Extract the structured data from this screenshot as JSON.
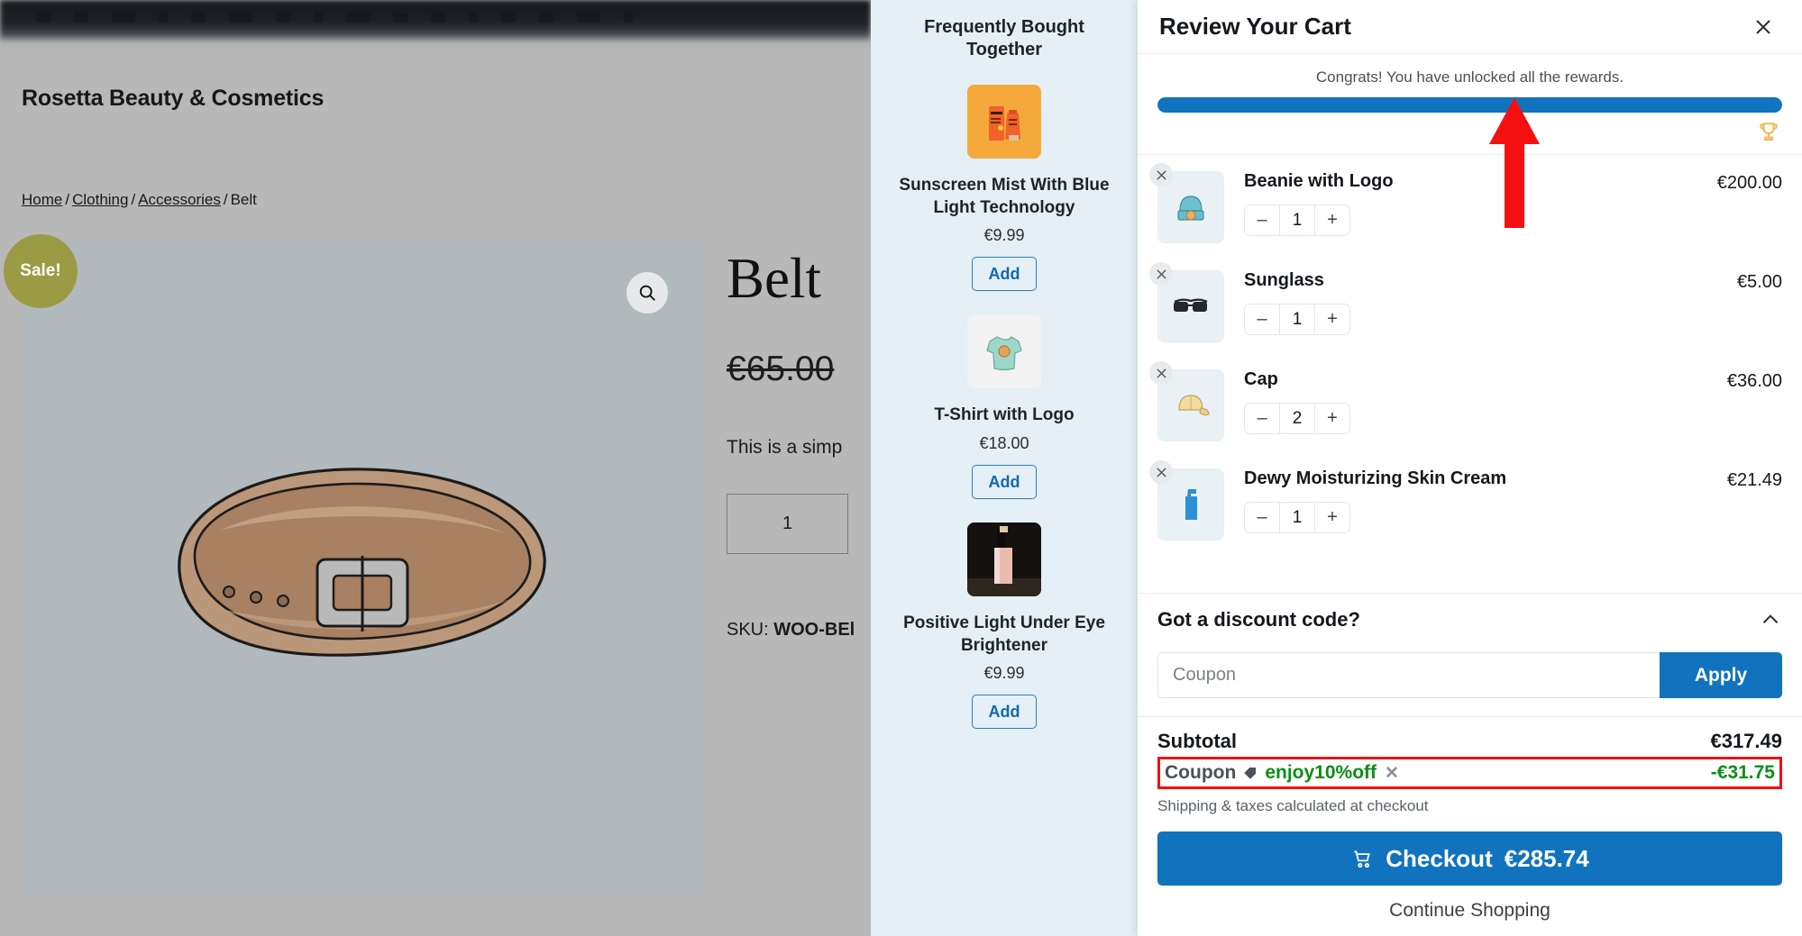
{
  "store": {
    "name": "Rosetta Beauty & Cosmetics",
    "breadcrumb": [
      {
        "label": "Home",
        "link": true
      },
      {
        "label": "Clothing",
        "link": true
      },
      {
        "label": "Accessories",
        "link": true
      },
      {
        "label": "Belt",
        "link": false
      }
    ],
    "breadcrumb_separator": "/"
  },
  "product": {
    "sale_badge": "Sale!",
    "title": "Belt",
    "old_price": "€65.00",
    "description": "This is a simp",
    "quantity": "1",
    "sku_label": "SKU:",
    "sku_value": "WOO-BEl",
    "zoom_icon": "search-icon"
  },
  "fbt": {
    "title": "Frequently Bought Together",
    "items": [
      {
        "name": "Sunscreen Mist With Blue Light Technology",
        "price": "€9.99",
        "add_label": "Add",
        "thumb": "sunscreen-tubes"
      },
      {
        "name": "T-Shirt with Logo",
        "price": "€18.00",
        "add_label": "Add",
        "thumb": "tshirt"
      },
      {
        "name": "Positive Light Under Eye Brightener",
        "price": "€9.99",
        "add_label": "Add",
        "thumb": "serum-bottle"
      }
    ]
  },
  "cart": {
    "title": "Review Your Cart",
    "close_icon": "close-icon",
    "rewards": {
      "message": "Congrats! You have unlocked all the rewards.",
      "progress_percent": 100,
      "trophy_icon": "trophy-icon"
    },
    "items": [
      {
        "name": "Beanie with Logo",
        "price": "€200.00",
        "qty": "1",
        "thumb": "beanie",
        "remove_icon": "close-icon",
        "minus": "–",
        "plus": "+"
      },
      {
        "name": "Sunglass",
        "price": "€5.00",
        "qty": "1",
        "thumb": "sunglasses",
        "remove_icon": "close-icon",
        "minus": "–",
        "plus": "+"
      },
      {
        "name": "Cap",
        "price": "€36.00",
        "qty": "2",
        "thumb": "cap",
        "remove_icon": "close-icon",
        "minus": "–",
        "plus": "+"
      },
      {
        "name": "Dewy Moisturizing Skin Cream",
        "price": "€21.49",
        "qty": "1",
        "thumb": "cream-pump",
        "remove_icon": "close-icon",
        "minus": "–",
        "plus": "+"
      }
    ],
    "discount": {
      "heading": "Got a discount code?",
      "collapse_icon": "chevron-up-icon",
      "input_value": "",
      "input_placeholder": "Coupon",
      "apply_label": "Apply"
    },
    "totals": {
      "subtotal_label": "Subtotal",
      "subtotal_value": "€317.49",
      "coupon_label": "Coupon",
      "coupon_tag_icon": "tag-icon",
      "coupon_code": "enjoy10%off",
      "coupon_remove_icon": "close-icon",
      "coupon_amount": "-€31.75",
      "shipping_note": "Shipping & taxes calculated at checkout"
    },
    "checkout_label": "Checkout",
    "checkout_total": "€285.74",
    "checkout_icon": "cart-icon",
    "continue_label": "Continue Shopping"
  },
  "annotation": {
    "arrow_color": "#f41010",
    "highlight_color": "#ee1111"
  },
  "colors": {
    "accent_blue": "#1173bd",
    "success_green": "#0a8f16",
    "fbt_background": "#e4eff6",
    "sale_badge": "#9b9b45",
    "trophy_gold": "#f0b849"
  }
}
